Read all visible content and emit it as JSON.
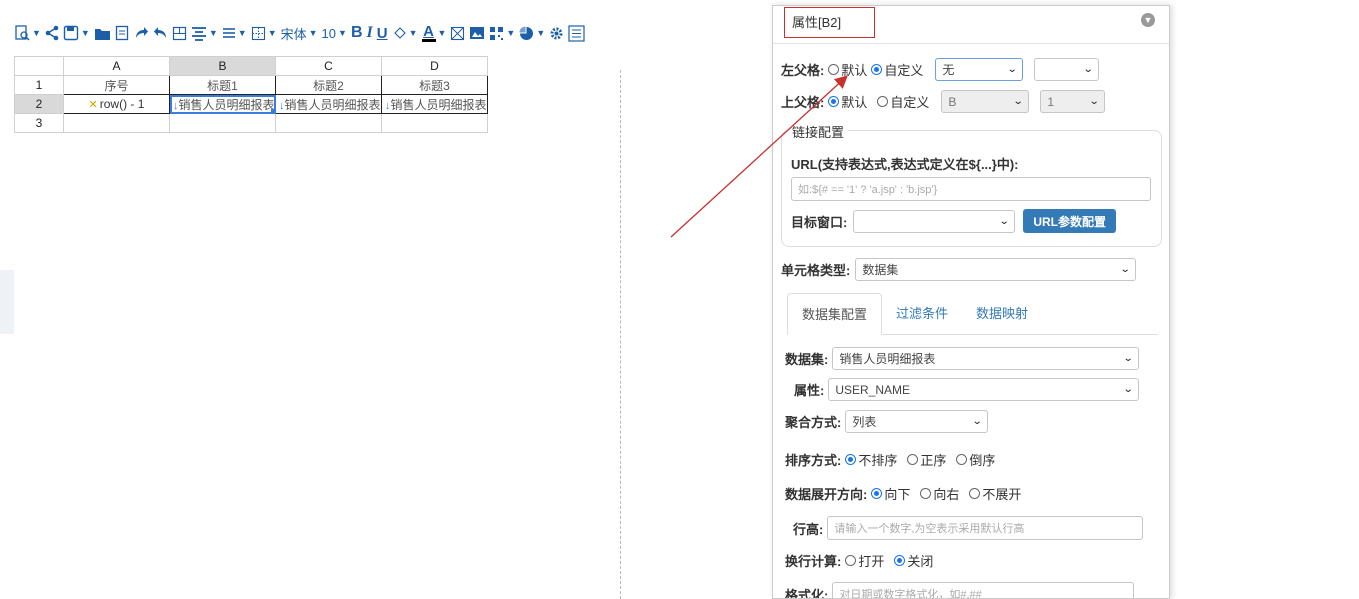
{
  "toolbar": {
    "font_name": "宋体",
    "font_size": "10",
    "bold": "B",
    "italic": "I",
    "underline": "U",
    "font_color": "A"
  },
  "sheet": {
    "columns": [
      "A",
      "B",
      "C",
      "D"
    ],
    "rows": [
      "1",
      "2",
      "3"
    ],
    "row1": [
      "序号",
      "标题1",
      "标题2",
      "标题3"
    ],
    "row2_formula": "row() - 1",
    "row2": [
      "销售人员明细报表",
      "销售人员明细报表",
      "销售人员明细报表"
    ],
    "selected_cell": "B2"
  },
  "panel": {
    "title": "属性[B2]",
    "left_parent": {
      "label": "左父格:",
      "opt_default": "默认",
      "opt_custom": "自定义",
      "selected": "custom",
      "select_value": "无",
      "select2_value": ""
    },
    "top_parent": {
      "label": "上父格:",
      "opt_default": "默认",
      "opt_custom": "自定义",
      "selected": "default",
      "select_value": "B",
      "select2_value": "1"
    },
    "link": {
      "legend": "链接配置",
      "url_label": "URL(支持表达式,表达式定义在${...}中):",
      "url_placeholder": "如:${# == '1' ? 'a.jsp' : 'b.jsp'}",
      "target_label": "目标窗口:",
      "target_value": "",
      "param_button": "URL参数配置"
    },
    "cell_type": {
      "label": "单元格类型:",
      "value": "数据集"
    },
    "tabs": [
      "数据集配置",
      "过滤条件",
      "数据映射"
    ],
    "dataset": {
      "label": "数据集:",
      "value": "销售人员明细报表"
    },
    "attribute": {
      "label": "属性:",
      "value": "USER_NAME"
    },
    "aggregate": {
      "label": "聚合方式:",
      "value": "列表"
    },
    "sort": {
      "label": "排序方式:",
      "options": [
        "不排序",
        "正序",
        "倒序"
      ],
      "selected": 0
    },
    "expand": {
      "label": "数据展开方向:",
      "options": [
        "向下",
        "向右",
        "不展开"
      ],
      "selected": 0
    },
    "row_height": {
      "label": "行高:",
      "placeholder": "请输入一个数字,为空表示采用默认行高"
    },
    "wrap": {
      "label": "换行计算:",
      "options": [
        "打开",
        "关闭"
      ],
      "selected": 1
    },
    "format": {
      "label": "格式化:",
      "placeholder": "对日期或数字格式化，如#.##"
    }
  },
  "colors": {
    "accent": "#337ab7",
    "toolbar_icon": "#1c5fa8",
    "annotation": "#c9302c",
    "selection": "#3b7ddd"
  }
}
